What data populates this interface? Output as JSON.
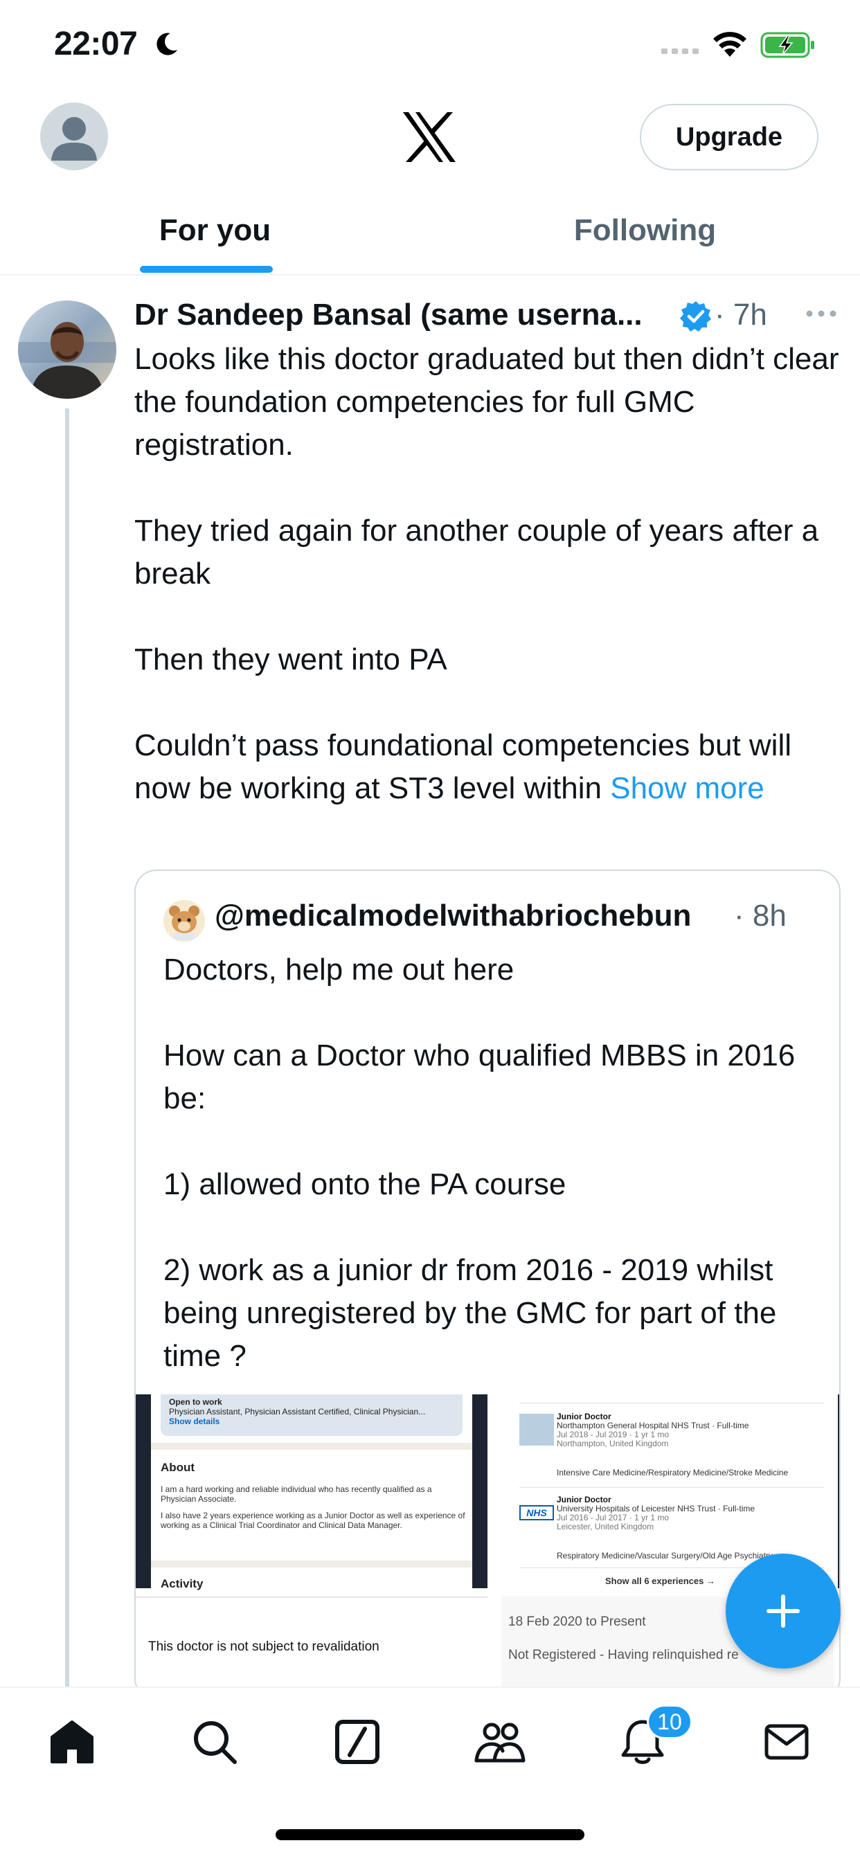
{
  "status_bar": {
    "time": "22:07"
  },
  "header": {
    "upgrade_label": "Upgrade"
  },
  "tabs": [
    {
      "label": "For you",
      "active": true
    },
    {
      "label": "Following",
      "active": false
    }
  ],
  "tweet": {
    "author_name": "Dr Sandeep Bansal (same userna...",
    "time": "· 7h",
    "body": [
      "Looks like this doctor graduated but then didn’t clear the foundation competencies for full GMC registration.",
      "They tried again for another couple of years after a break",
      "Then they went into PA",
      "Couldn’t pass foundational competencies but will now be working at ST3 level within "
    ],
    "show_more": "Show more"
  },
  "quote": {
    "handle": "@medicalmodelwithabriochebun",
    "time": "· 8h",
    "body": [
      "Doctors, help me out here",
      "How can a Doctor who qualified MBBS in 2016 be:",
      "1) allowed onto the PA course",
      "2) work as a junior dr from 2016 - 2019 whilst being unregistered by the GMC for part of the time ?"
    ],
    "media_left": {
      "open_to_work": "Open to work",
      "roles": "Physician Assistant, Physician Assistant Certified, Clinical Physician...",
      "show_details": "Show details",
      "about_title": "About",
      "about_text_1": "I am a hard working and reliable individual who has recently qualified as a Physician Associate.",
      "about_text_2": "I also have 2 years experience working as a Junior Doctor as well as experience of working as a Clinical Trial Coordinator and Clinical Data Manager.",
      "activity": "Activity",
      "revalidation": "This doctor is not subject to revalidation"
    },
    "media_right": {
      "job1_title": "Junior Doctor",
      "job1_org": "Northampton General Hospital NHS Trust · Full-time",
      "job1_dates": "Jul 2018 - Jul 2019 · 1 yr 1 mo",
      "job1_loc": "Northampton, United Kingdom",
      "job1_spec": "Intensive Care Medicine/Respiratory Medicine/Stroke Medicine",
      "job2_title": "Junior Doctor",
      "job2_org": "University Hospitals of Leicester NHS Trust · Full-time",
      "job2_dates": "Jul 2016 - Jul 2017 · 1 yr 1 mo",
      "job2_loc": "Leicester, United Kingdom",
      "job2_spec": "Respiratory Medicine/Vascular Surgery/Old Age Psychiatry",
      "nhs_logo": "NHS",
      "show_all": "Show all 6 experiences →",
      "date_range": "18 Feb 2020   to   Present",
      "status": "Not Registered - Having relinquished re"
    }
  },
  "nav": {
    "items": [
      "home-icon",
      "search-icon",
      "grok-icon",
      "communities-icon",
      "notifications-icon",
      "messages-icon"
    ],
    "notifications_count": "10"
  },
  "colors": {
    "accent": "#1d9bf0",
    "text": "#0f1419",
    "secondary": "#536471",
    "border": "#cfd9de"
  }
}
